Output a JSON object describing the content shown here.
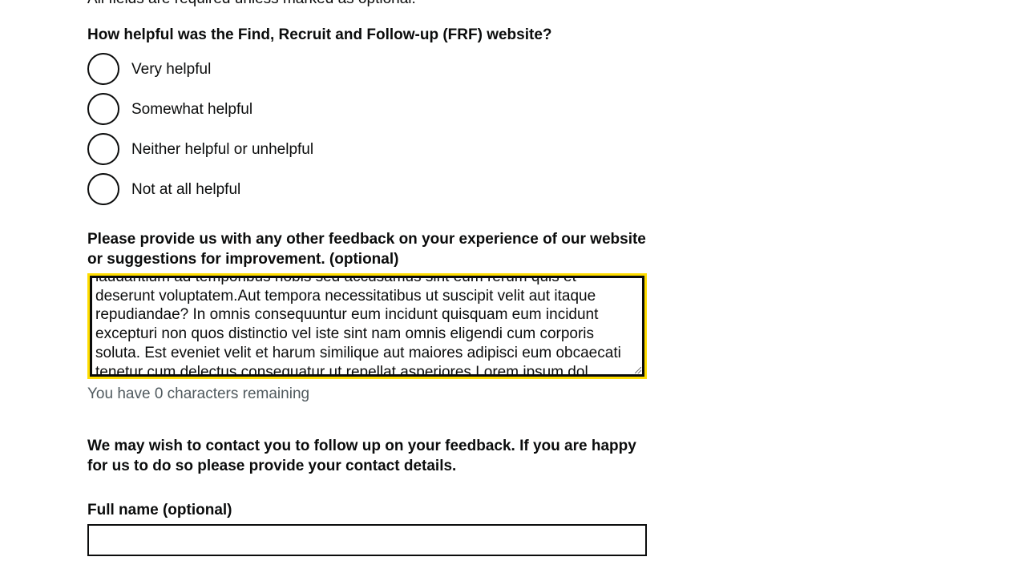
{
  "form": {
    "intro_text": "All fields are required unless marked as optional.",
    "question_helpful": "How helpful was the Find, Recruit and Follow-up (FRF) website?",
    "options": [
      {
        "label": "Very helpful",
        "selected": false
      },
      {
        "label": "Somewhat helpful",
        "selected": false
      },
      {
        "label": "Neither helpful or unhelpful",
        "selected": false
      },
      {
        "label": "Not at all helpful",
        "selected": false
      }
    ],
    "feedback_label": "Please provide us with any other feedback on your experience of our website or suggestions for improvement. (optional)",
    "feedback_value": "laudantium ad temporibus nobis sed accusamus sint eum rerum quis et deserunt voluptatem.Aut tempora necessitatibus ut suscipit velit aut itaque repudiandae? In omnis consequuntur eum incidunt quisquam eum incidunt excepturi non quos distinctio vel iste sint nam omnis eligendi cum corporis soluta. Est eveniet velit et harum similique aut maiores adipisci eum obcaecati tenetur cum delectus consequatur ut repellat asperiores.Lorem ipsum dol",
    "char_hint": "You have 0 characters remaining",
    "contact_heading": "We may wish to contact you to follow up on your feedback. If you are happy for us to do so please provide your contact details.",
    "full_name_label": "Full name (optional)",
    "full_name_value": ""
  },
  "colors": {
    "focus": "#ffdd00",
    "text": "#0b0c0c",
    "hint": "#505a5f"
  }
}
